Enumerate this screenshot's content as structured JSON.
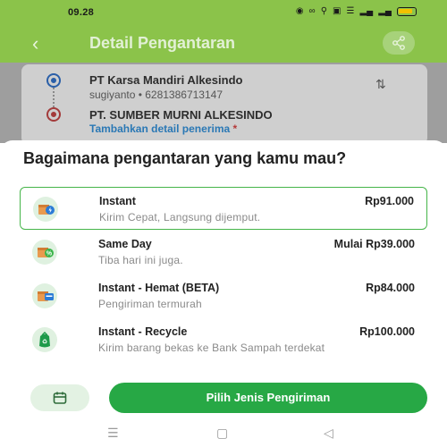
{
  "status_bar": {
    "time": "09.28",
    "icons": [
      "camera-notif-icon",
      "voice-icon",
      "location-icon",
      "data-icon",
      "wifi-icon",
      "signal-icon",
      "signal-icon",
      "battery-icon"
    ]
  },
  "header": {
    "title": "Detail Pengantaran",
    "back_icon": "back-arrow-icon",
    "share_icon": "share-icon"
  },
  "route": {
    "sender_name": "PT Karsa Mandiri Alkesindo",
    "sender_contact": "sugiyanto • 6281386713147",
    "receiver_name": "PT. SUMBER MURNI ALKESINDO",
    "receiver_detail_link": "Tambahkan detail penerima",
    "required_mark": "*"
  },
  "sheet": {
    "title": "Bagaimana pengantaran yang kamu mau?",
    "options": [
      {
        "name": "Instant",
        "price": "Rp91.000",
        "desc": "Kirim Cepat, Langsung dijemput.",
        "icon": "instant-box-icon",
        "selected": true
      },
      {
        "name": "Same Day",
        "price": "Mulai Rp39.000",
        "desc": "Tiba hari ini juga.",
        "icon": "same-day-box-icon",
        "selected": false
      },
      {
        "name": "Instant - Hemat (BETA)",
        "price": "Rp84.000",
        "desc": "Pengiriman termurah",
        "icon": "hemat-box-icon",
        "selected": false
      },
      {
        "name": "Instant - Recycle",
        "price": "Rp100.000",
        "desc": "Kirim barang bekas ke Bank Sampah terdekat",
        "icon": "recycle-bag-icon",
        "selected": false
      }
    ],
    "primary_button": "Pilih Jenis Pengiriman",
    "calendar_icon": "calendar-icon"
  },
  "colors": {
    "brand_green": "#8bc34a",
    "button_green": "#27a845",
    "selected_border": "#45b549",
    "link_blue": "#2a78b5"
  },
  "nav_bar": {
    "icons": [
      "menu-icon",
      "home-icon",
      "back-icon"
    ]
  }
}
